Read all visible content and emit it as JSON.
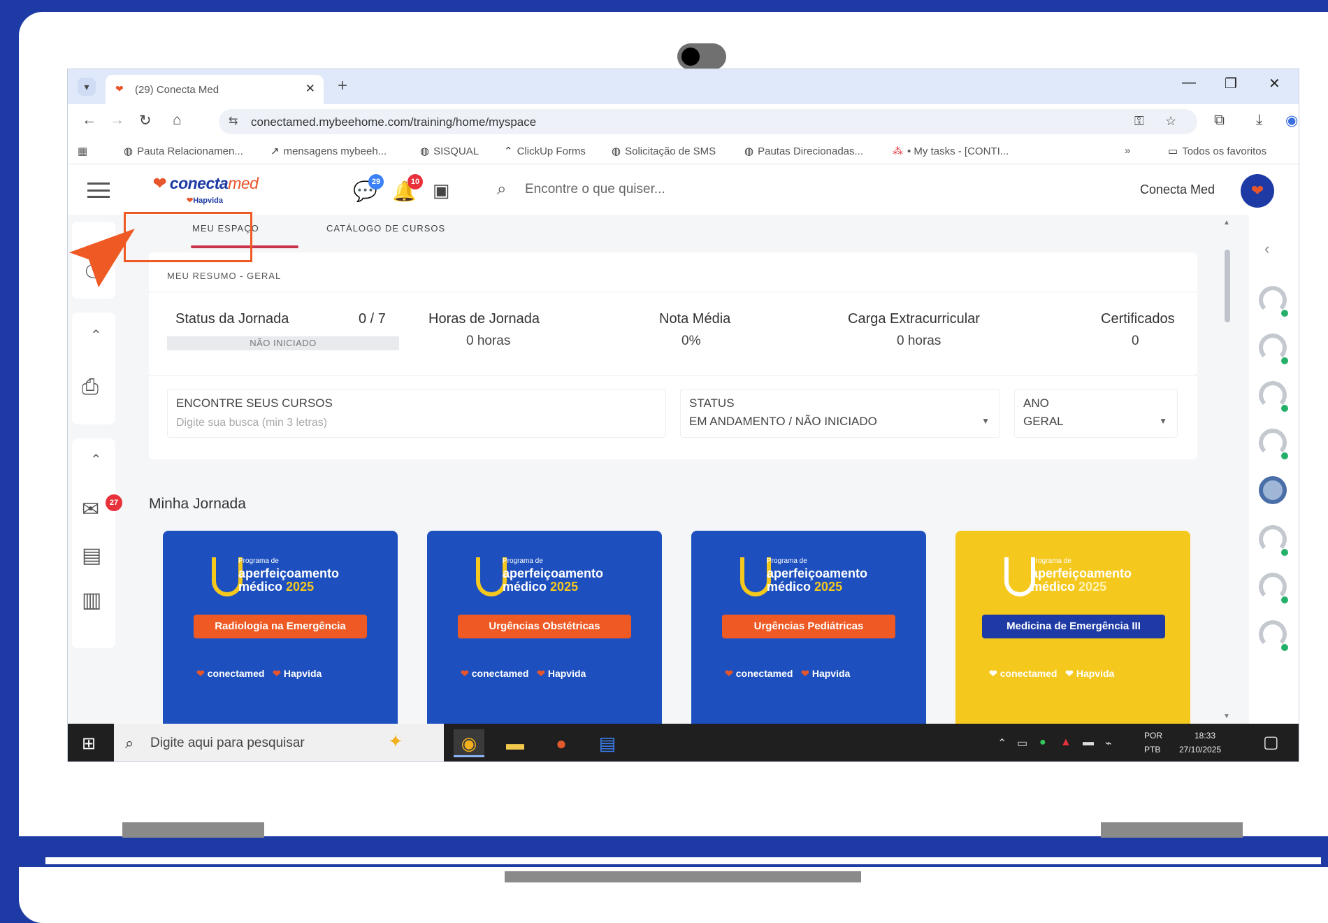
{
  "browser": {
    "tab_title": "(29) Conecta Med",
    "url": "conectamed.mybeehome.com/training/home/myspace",
    "bookmarks": [
      {
        "label": "Pauta Relacionamen..."
      },
      {
        "label": "mensagens mybeeh..."
      },
      {
        "label": "SISQUAL"
      },
      {
        "label": "ClickUp Forms"
      },
      {
        "label": "Solicitação de SMS"
      },
      {
        "label": "Pautas Direcionadas..."
      },
      {
        "label": "• My tasks - [CONTI..."
      }
    ],
    "all_favorites": "Todos os favoritos"
  },
  "app": {
    "logo": {
      "main": "conecta",
      "main_accent": "med",
      "sub": "Hapvida"
    },
    "header_badges": {
      "chat": "29",
      "notifications": "10"
    },
    "search_placeholder": "Encontre o que quiser...",
    "user_name": "Conecta  Med",
    "rail_badge": "27"
  },
  "tabs": {
    "meu_espaco": "MEU ESPAÇO",
    "catalogo": "CATÁLOGO DE CURSOS"
  },
  "summary": {
    "heading": "MEU RESUMO - GERAL",
    "status_label": "Status da Jornada",
    "status_value": "0 / 7",
    "status_progress": "NÃO INICIADO",
    "hours_label": "Horas de Jornada",
    "hours_value": "0 horas",
    "grade_label": "Nota Média",
    "grade_value": "0%",
    "extra_label": "Carga Extracurricular",
    "extra_value": "0 horas",
    "cert_label": "Certificados",
    "cert_value": "0"
  },
  "filters": {
    "search_label": "ENCONTRE SEUS CURSOS",
    "search_placeholder": "Digite sua busca (min 3 letras)",
    "status_label": "STATUS",
    "status_value": "EM ANDAMENTO / NÃO INICIADO",
    "year_label": "ANO",
    "year_value": "GERAL"
  },
  "journey": {
    "title": "Minha Jornada",
    "program_small": "Programa de",
    "program_line1": "aperfeiçoamento",
    "program_line2": "médico",
    "program_year": "2025",
    "footer_brand": "conectamed",
    "footer_partner": "Hapvida",
    "courses": [
      {
        "name": "Radiologia na Emergência"
      },
      {
        "name": "Urgências Obstétricas"
      },
      {
        "name": "Urgências Pediátricas"
      },
      {
        "name": "Medicina de Emergência III"
      }
    ]
  },
  "taskbar": {
    "search_placeholder": "Digite aqui para pesquisar",
    "lang_line1": "POR",
    "lang_line2": "PTB",
    "time": "18:33",
    "date": "27/10/2025"
  },
  "colors": {
    "frame_blue": "#1d3aa5",
    "accent_orange": "#ef5a24",
    "card_blue": "#1d4fbf",
    "card_yellow": "#f5c81e",
    "tab_underline": "#c8344b"
  }
}
